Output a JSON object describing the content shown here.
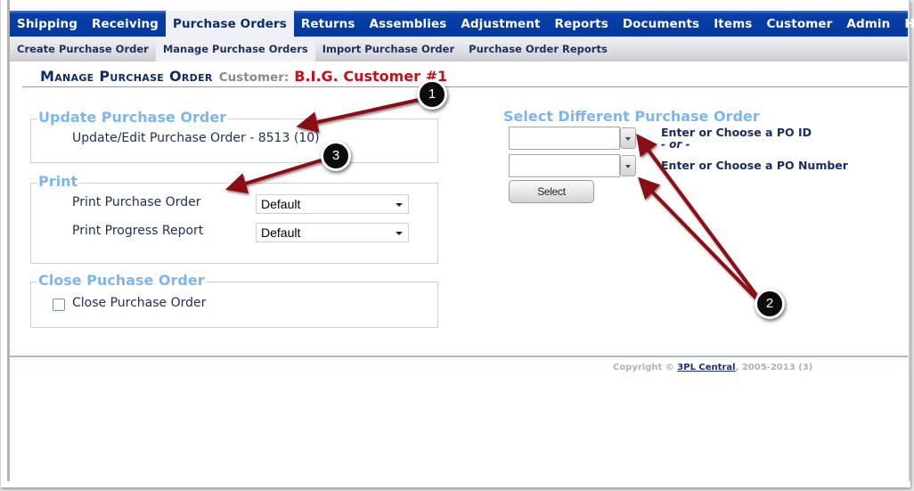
{
  "main_nav": {
    "items": [
      {
        "label": "Shipping",
        "active": false
      },
      {
        "label": "Receiving",
        "active": false
      },
      {
        "label": "Purchase Orders",
        "active": true
      },
      {
        "label": "Returns",
        "active": false
      },
      {
        "label": "Assemblies",
        "active": false
      },
      {
        "label": "Adjustment",
        "active": false
      },
      {
        "label": "Reports",
        "active": false
      },
      {
        "label": "Documents",
        "active": false
      },
      {
        "label": "Items",
        "active": false
      },
      {
        "label": "Customer",
        "active": false
      },
      {
        "label": "Admin",
        "active": false
      },
      {
        "label": "Home",
        "active": false
      }
    ]
  },
  "sub_nav": {
    "items": [
      {
        "label": "Create Purchase Order",
        "active": false
      },
      {
        "label": "Manage Purchase Orders",
        "active": true
      },
      {
        "label": "Import Purchase Order",
        "active": false
      },
      {
        "label": "Purchase Order Reports",
        "active": false
      }
    ]
  },
  "header": {
    "title": "Manage Purchase Order",
    "customer_label": "Customer:",
    "customer_name": "B.I.G. Customer #1"
  },
  "update_section": {
    "legend": "Update Purchase Order",
    "link": "Update/Edit Purchase Order - 8513 (10)"
  },
  "print_section": {
    "legend": "Print",
    "rows": [
      {
        "label": "Print Purchase Order",
        "selected": "Default"
      },
      {
        "label": "Print Progress Report",
        "selected": "Default"
      }
    ]
  },
  "close_section": {
    "legend": "Close Puchase Order",
    "checkbox_label": "Close Purchase Order",
    "checked": false
  },
  "select_section": {
    "heading": "Select Different Purchase Order",
    "po_id_value": "",
    "po_id_label": "Enter or Choose a PO ID",
    "or_label": "- or -",
    "po_number_value": "",
    "po_number_label": "Enter or Choose a PO Number",
    "select_button": "Select"
  },
  "footer": {
    "prefix": "Copyright ©",
    "link": "3PL Central",
    "suffix": ", 2005-2013 (3)"
  },
  "annotations": {
    "badges": [
      "1",
      "2",
      "3"
    ],
    "arrow_color": "#8b1116"
  }
}
